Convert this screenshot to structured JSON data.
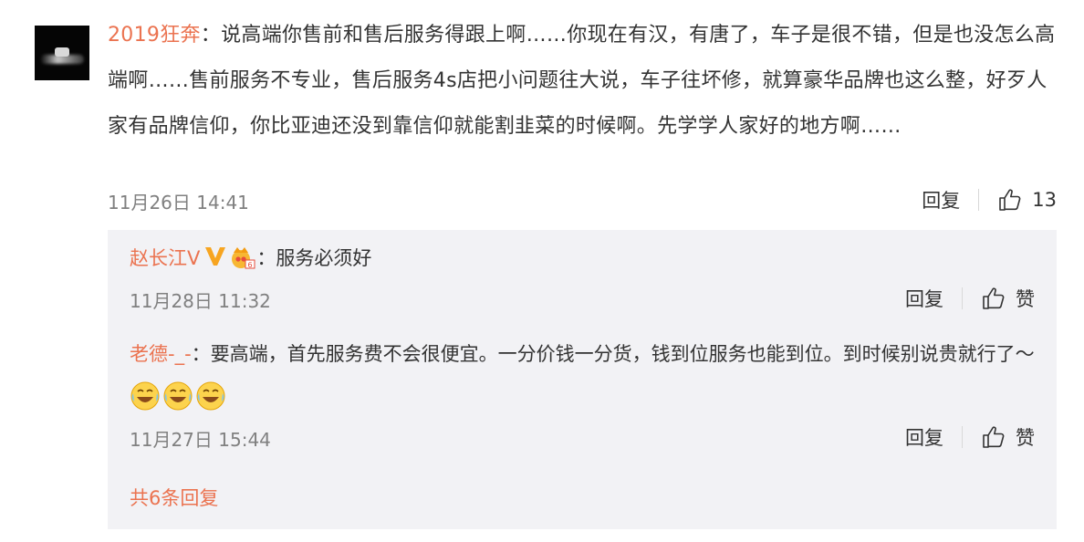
{
  "comment": {
    "author": "2019狂奔",
    "text": "：说高端你售前和售后服务得跟上啊……你现在有汉，有唐了，车子是很不错，但是也没怎么高端啊……售前服务不专业，售后服务4s店把小问题往大说，车子往坏修，就算豪华品牌也这么整，好歹人家有品牌信仰，你比亚迪还没到靠信仰就能割韭菜的时候啊。先学学人家好的地方啊……",
    "time": "11月26日 14:41",
    "reply_label": "回复",
    "like_count": "13"
  },
  "replies": [
    {
      "author": "赵长江V",
      "text": "：服务必须好",
      "time": "11月28日 11:32",
      "reply_label": "回复",
      "like_label": "赞"
    },
    {
      "author": "老德-_-",
      "text": "：要高端，首先服务费不会很便宜。一分价钱一分货，钱到位服务也能到位。到时候别说贵就行了～",
      "time": "11月27日 15:44",
      "reply_label": "回复",
      "like_label": "赞"
    }
  ],
  "more_replies": "共6条回复",
  "colors": {
    "name": "#eb7350",
    "meta": "#808080",
    "sub_bg": "#f2f2f5",
    "vip": "#f7a521"
  },
  "icons": [
    "user-avatar",
    "thumb-up-icon",
    "verified-v-icon",
    "vip-crown-icon",
    "laugh-cry-emoji"
  ]
}
